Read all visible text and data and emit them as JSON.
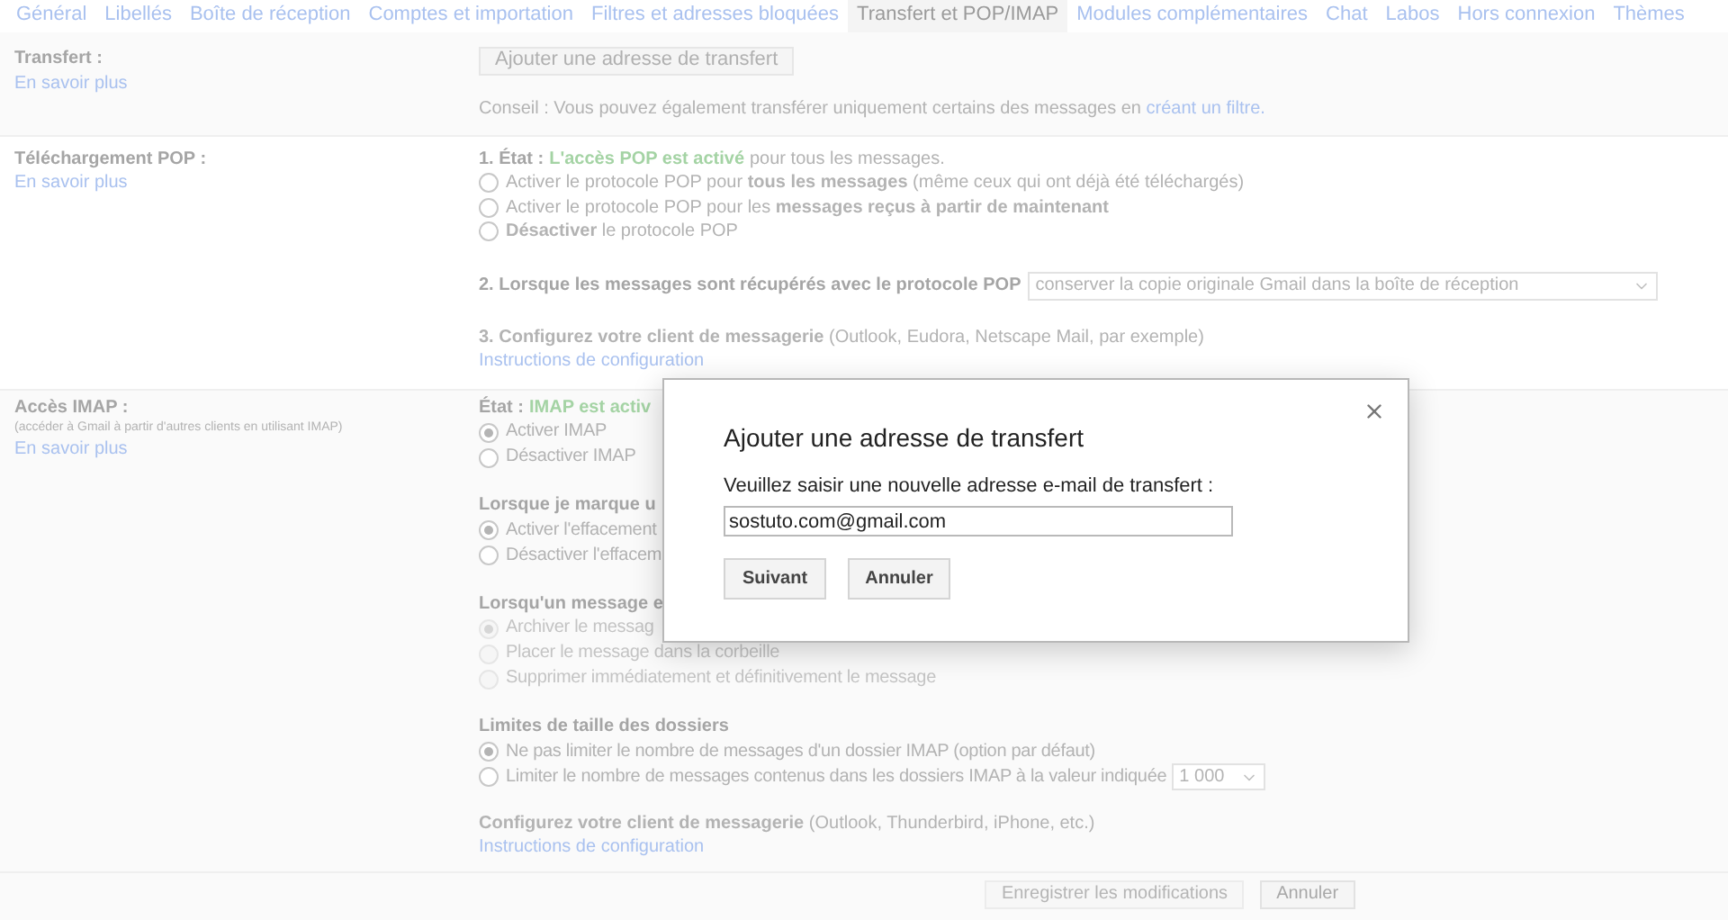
{
  "tabs": [
    {
      "label": "Général",
      "selected": false
    },
    {
      "label": "Libellés",
      "selected": false
    },
    {
      "label": "Boîte de réception",
      "selected": false
    },
    {
      "label": "Comptes et importation",
      "selected": false
    },
    {
      "label": "Filtres et adresses bloquées",
      "selected": false
    },
    {
      "label": "Transfert et POP/IMAP",
      "selected": true
    },
    {
      "label": "Modules complémentaires",
      "selected": false
    },
    {
      "label": "Chat",
      "selected": false
    },
    {
      "label": "Labos",
      "selected": false
    },
    {
      "label": "Hors connexion",
      "selected": false
    },
    {
      "label": "Thèmes",
      "selected": false
    }
  ],
  "forwarding": {
    "label": "Transfert :",
    "learn_more": "En savoir plus",
    "add_button": "Ajouter une adresse de transfert",
    "tip": "Conseil : Vous pouvez également transférer uniquement certains des messages en",
    "tip_link": "créant un filtre."
  },
  "pop": {
    "label": "Téléchargement POP :",
    "learn_more": "En savoir plus",
    "status_label": "1. État :",
    "status_value": "L'accès POP est activé",
    "status_suffix": "pour tous les messages.",
    "options": [
      {
        "label": "Activer le protocole POP pour **tous les messages** (même ceux qui ont déjà été téléchargés)",
        "selected": false
      },
      {
        "label": "Activer le protocole POP pour les **messages reçus à partir de maintenant**",
        "selected": false
      },
      {
        "label": "**Désactiver** le protocole POP",
        "selected": false
      }
    ],
    "step2_label": "2. Lorsque les messages sont récupérés avec le protocole POP",
    "step2_select": "conserver la copie originale Gmail dans la boîte de réception",
    "step3": "**3. Configurez votre client de messagerie** (Outlook, Eudora, Netscape Mail, par exemple)",
    "step3_link": "Instructions de configuration"
  },
  "imap": {
    "label": "Accès IMAP :",
    "note": "(accéder à Gmail à partir d'autres clients en utilisant IMAP)",
    "learn_more": "En savoir plus",
    "status_label": "État :",
    "status_value": "IMAP est activ",
    "groups": [
      {
        "options": [
          {
            "label": "Activer IMAP",
            "selected": true,
            "disabled": false
          },
          {
            "label": "Désactiver IMAP",
            "selected": false,
            "disabled": false
          }
        ]
      },
      {
        "heading": "Lorsque je marque u",
        "options": [
          {
            "label": "Activer l'effacement",
            "selected": true,
            "disabled": false
          },
          {
            "label": "Désactiver l'effacem",
            "selected": false,
            "disabled": false
          }
        ]
      },
      {
        "heading": "Lorsqu'un message e",
        "options": [
          {
            "label": "Archiver le messag",
            "selected": true,
            "disabled": true
          },
          {
            "label": "Placer le message dans la corbeille",
            "selected": false,
            "disabled": true
          },
          {
            "label": "Supprimer immédiatement et définitivement le message",
            "selected": false,
            "disabled": true
          }
        ]
      },
      {
        "heading": "Limites de taille des dossiers",
        "options": [
          {
            "label": "Ne pas limiter le nombre de messages d'un dossier IMAP (option par défaut)",
            "selected": true,
            "disabled": false
          },
          {
            "label": "Limiter le nombre de messages contenus dans les dossiers IMAP à la valeur indiquée",
            "selected": false,
            "disabled": false,
            "select": "1 000"
          }
        ]
      }
    ],
    "config": "**Configurez votre client de messagerie** (Outlook, Thunderbird, iPhone, etc.)",
    "config_link": "Instructions de configuration"
  },
  "footer": {
    "save_button": "Enregistrer les modifications",
    "save_disabled": true,
    "cancel_button": "Annuler"
  },
  "dialog": {
    "title": "Ajouter une adresse de transfert",
    "prompt": "Veuillez saisir une nouvelle adresse e-mail de transfert :",
    "value": "sostuto.com@gmail.com",
    "next_button": "Suivant",
    "cancel_button": "Annuler"
  }
}
